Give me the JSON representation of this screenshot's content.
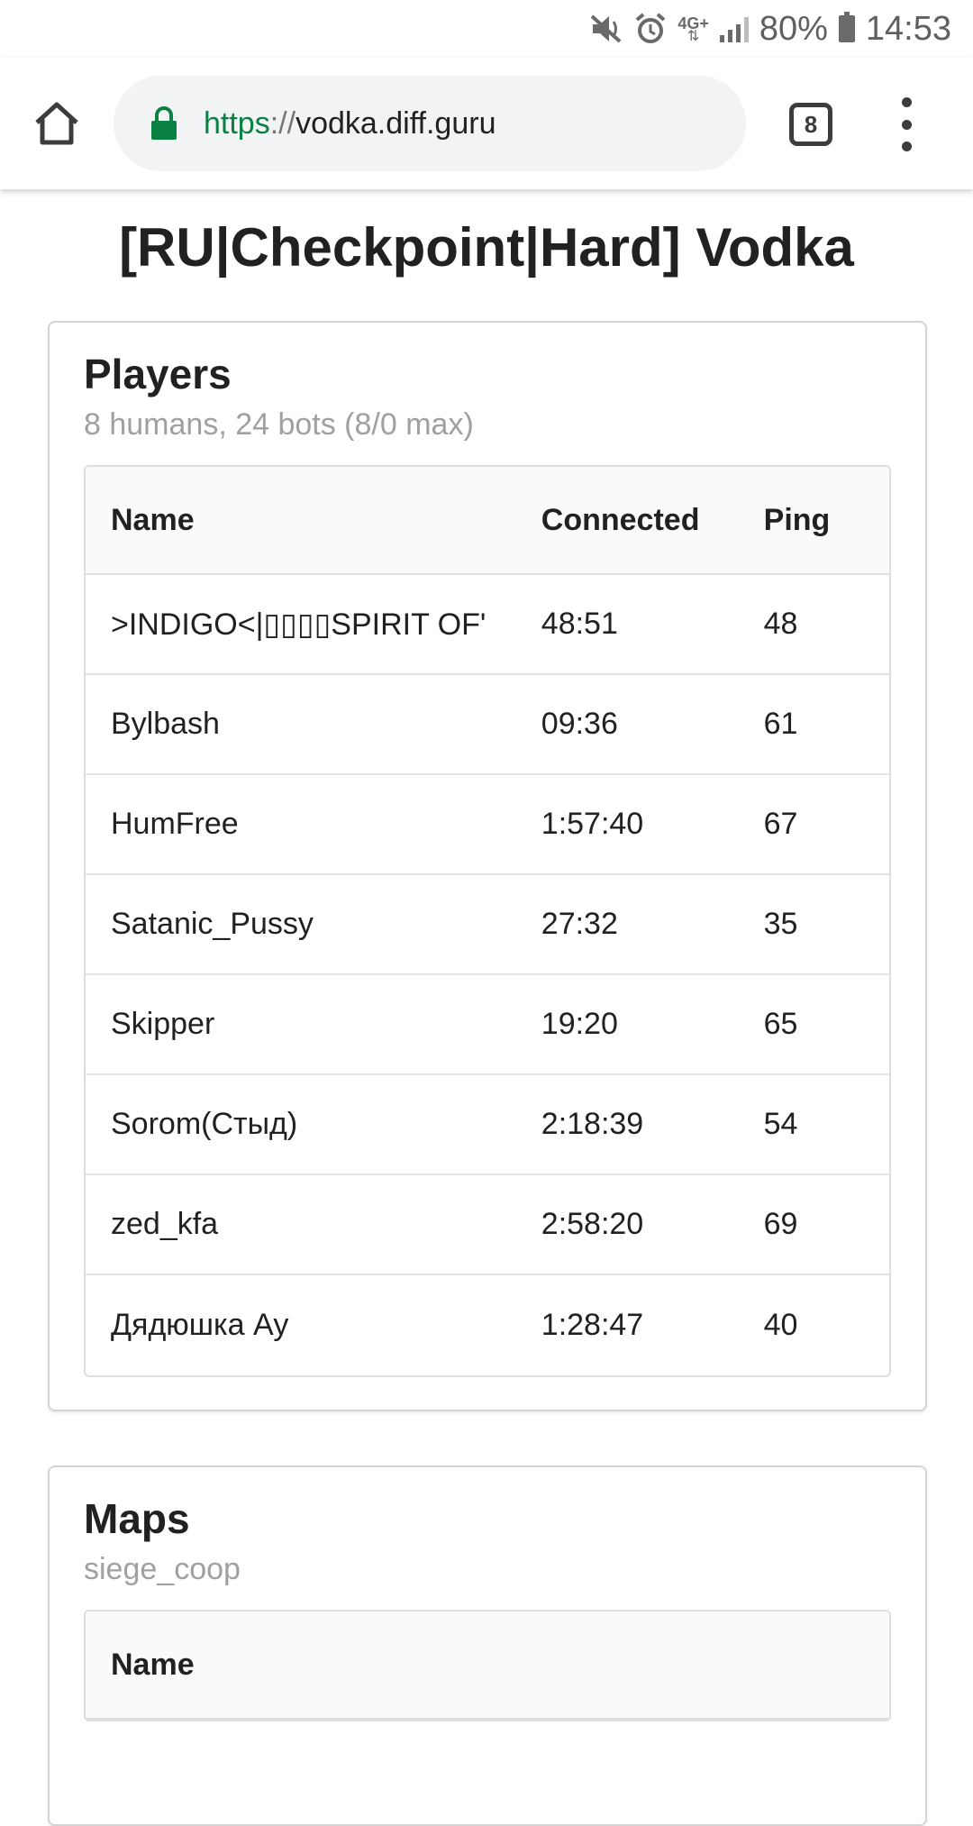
{
  "status_bar": {
    "network": "4G+",
    "battery": "80%",
    "time": "14:53"
  },
  "browser": {
    "url_scheme": "https",
    "url_separator": "://",
    "url_host": "vodka.diff.guru",
    "tab_count": "8"
  },
  "page": {
    "title": "[RU|Checkpoint|Hard] Vodka"
  },
  "players": {
    "header": "Players",
    "meta": "8 humans, 24 bots (8/0 max)",
    "columns": [
      "Name",
      "Connected",
      "Ping"
    ],
    "rows": [
      {
        "name": ">INDIGO<|▯▯▯▯SPIRIT OF'",
        "connected": "48:51",
        "ping": "48"
      },
      {
        "name": "Bylbash",
        "connected": "09:36",
        "ping": "61"
      },
      {
        "name": "HumFree",
        "connected": "1:57:40",
        "ping": "67"
      },
      {
        "name": "Satanic_Pussy",
        "connected": "27:32",
        "ping": "35"
      },
      {
        "name": "Skipper",
        "connected": "19:20",
        "ping": "65"
      },
      {
        "name": "Sorom(Стыд)",
        "connected": "2:18:39",
        "ping": "54"
      },
      {
        "name": "zed_kfa",
        "connected": "2:58:20",
        "ping": "69"
      },
      {
        "name": "Дядюшка Ау",
        "connected": "1:28:47",
        "ping": "40"
      }
    ]
  },
  "maps": {
    "header": "Maps",
    "meta": "siege_coop",
    "columns": [
      "Name"
    ]
  },
  "icons": {
    "mute": "mute-icon",
    "alarm": "alarm-icon",
    "signal": "signal-icon",
    "battery": "battery-icon",
    "home": "home-icon",
    "lock": "lock-icon",
    "menu": "more-vert-icon"
  },
  "colors": {
    "secure_green": "#0b8043",
    "meta_gray": "#a0a0a0",
    "table_header_bg": "#f9fafb"
  }
}
